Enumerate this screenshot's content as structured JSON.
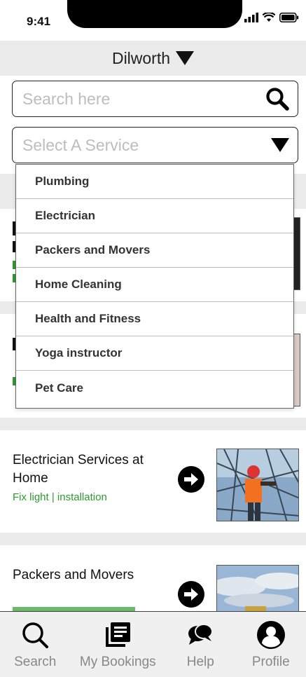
{
  "status_bar": {
    "time": "9:41"
  },
  "location": {
    "name": "Dilworth"
  },
  "search": {
    "placeholder": "Search here"
  },
  "service_select": {
    "placeholder": "Select A Service",
    "options": [
      "Plumbing",
      "Electrician",
      "Packers and Movers",
      "Home Cleaning",
      "Health and Fitness",
      "Yoga instructor",
      "Pet Care"
    ]
  },
  "cards": [
    {
      "title": "Electrician Services at Home",
      "subtitle": "Fix light | installation",
      "image": "electrician-photo"
    },
    {
      "title": "Packers and Movers",
      "subtitle": "",
      "image": "sky-photo"
    }
  ],
  "bottom_nav": [
    {
      "label": "Search",
      "icon": "search-icon"
    },
    {
      "label": "My Bookings",
      "icon": "bookings-icon"
    },
    {
      "label": "Help",
      "icon": "chat-icon"
    },
    {
      "label": "Profile",
      "icon": "profile-icon"
    }
  ],
  "colors": {
    "accent_green": "#2e9a2e",
    "band_gray": "#ebebeb"
  }
}
